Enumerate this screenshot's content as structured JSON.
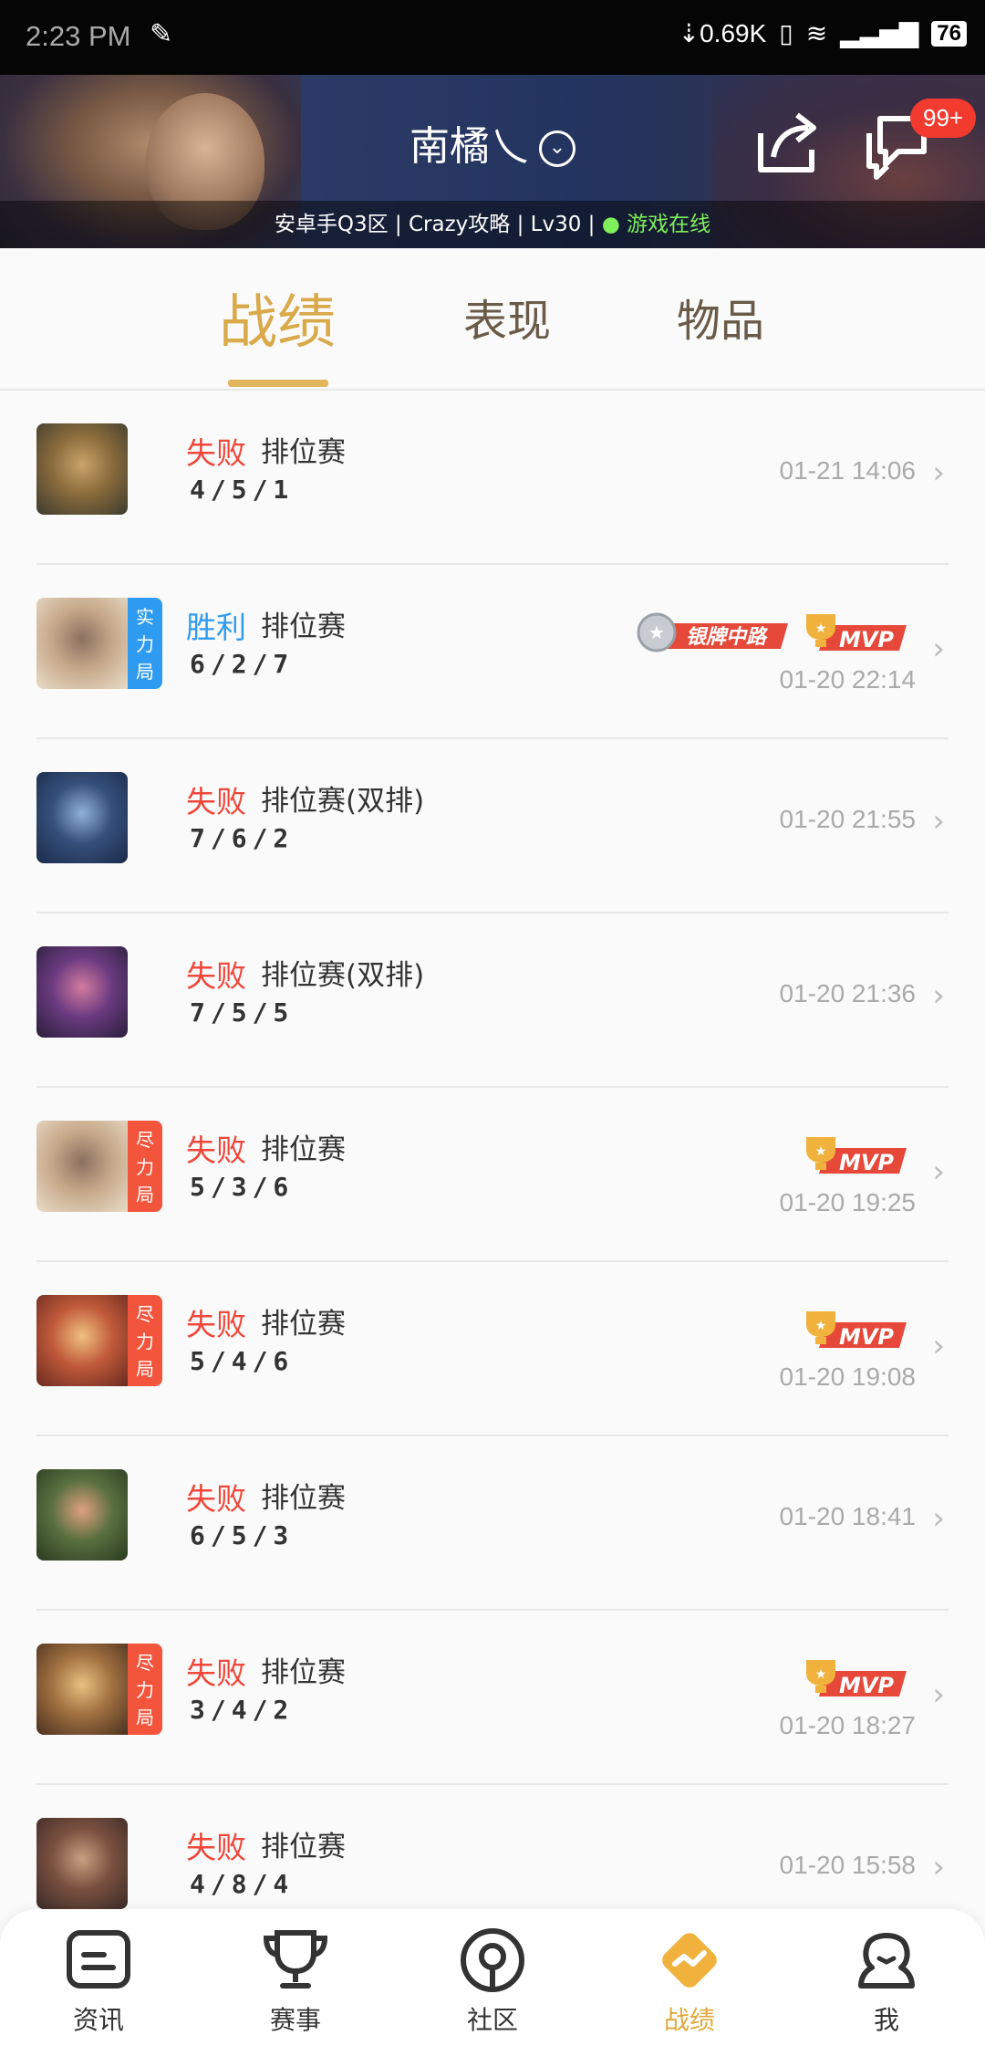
{
  "status_bar": {
    "time": "2:23 PM",
    "speed": "⇣0.69K",
    "battery": "76"
  },
  "header": {
    "username": "南橘乀",
    "badge": "99+",
    "server": "安卓手Q3区",
    "guild": "Crazy攻略",
    "level": "Lv30",
    "online_status": "游戏在线"
  },
  "tabs": [
    "战绩",
    "表现",
    "物品"
  ],
  "records": [
    {
      "result": "失败",
      "mode": "排位赛",
      "kda": "4/5/1",
      "time": "01-21 14:06",
      "tag": "",
      "mvp": false,
      "silver": false
    },
    {
      "result": "胜利",
      "mode": "排位赛",
      "kda": "6/2/7",
      "time": "01-20 22:14",
      "tag": "实力局",
      "mvp": true,
      "silver": true
    },
    {
      "result": "失败",
      "mode": "排位赛(双排)",
      "kda": "7/6/2",
      "time": "01-20 21:55",
      "tag": "",
      "mvp": false,
      "silver": false
    },
    {
      "result": "失败",
      "mode": "排位赛(双排)",
      "kda": "7/5/5",
      "time": "01-20 21:36",
      "tag": "",
      "mvp": false,
      "silver": false
    },
    {
      "result": "失败",
      "mode": "排位赛",
      "kda": "5/3/6",
      "time": "01-20 19:25",
      "tag": "尽力局",
      "mvp": true,
      "silver": false
    },
    {
      "result": "失败",
      "mode": "排位赛",
      "kda": "5/4/6",
      "time": "01-20 19:08",
      "tag": "尽力局",
      "mvp": true,
      "silver": false
    },
    {
      "result": "失败",
      "mode": "排位赛",
      "kda": "6/5/3",
      "time": "01-20 18:41",
      "tag": "",
      "mvp": false,
      "silver": false
    },
    {
      "result": "失败",
      "mode": "排位赛",
      "kda": "3/4/2",
      "time": "01-20 18:27",
      "tag": "尽力局",
      "mvp": true,
      "silver": false
    },
    {
      "result": "失败",
      "mode": "排位赛",
      "kda": "4/8/4",
      "time": "01-20 15:58",
      "tag": "",
      "mvp": false,
      "silver": false
    }
  ],
  "badges": {
    "mvp": "MVP",
    "silver": "银牌中路"
  },
  "bottom_nav": [
    "资讯",
    "赛事",
    "社区",
    "战绩",
    "我"
  ],
  "colors": {
    "accent": "#e0a83a",
    "lose": "#f0473a",
    "win": "#2f9bf0",
    "online": "#7ff05b"
  }
}
